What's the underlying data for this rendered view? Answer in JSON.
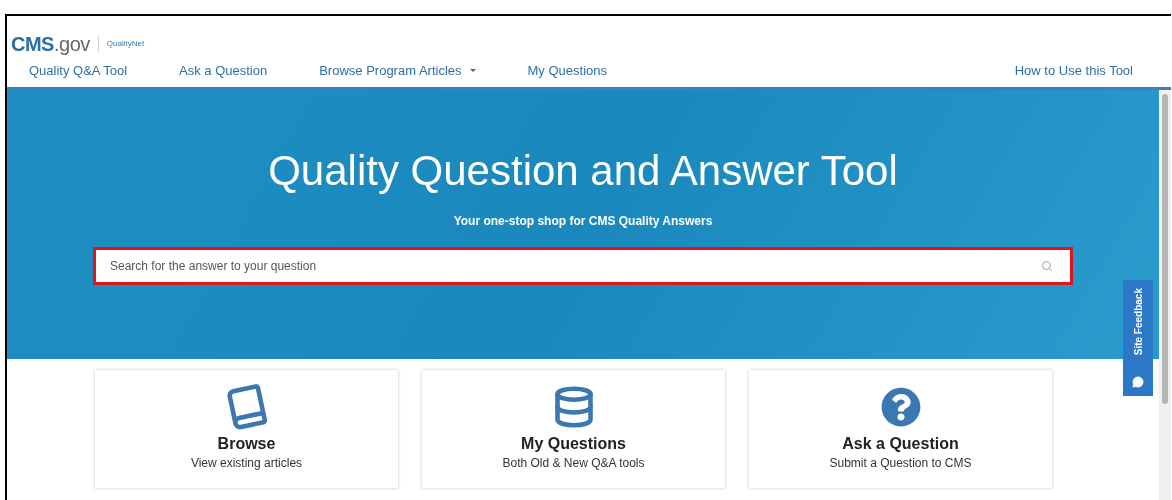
{
  "logo": {
    "brand": "CMS",
    "domain": ".gov",
    "sub": "QualityNet"
  },
  "nav": [
    {
      "label": "Quality Q&A Tool",
      "has_menu": false
    },
    {
      "label": "Ask a Question",
      "has_menu": false
    },
    {
      "label": "Browse Program Articles",
      "has_menu": true
    },
    {
      "label": "My Questions",
      "has_menu": false
    }
  ],
  "nav_right": {
    "label": "How to Use this Tool"
  },
  "hero": {
    "title": "Quality Question and Answer Tool",
    "subtitle": "Your one-stop shop for CMS Quality Answers",
    "search": {
      "placeholder": "Search for the answer to your question"
    }
  },
  "feedback": {
    "label": "Site Feedback"
  },
  "cards": [
    {
      "kind": "book",
      "title": "Browse",
      "subtitle": "View existing articles"
    },
    {
      "kind": "database",
      "title": "My Questions",
      "subtitle": "Both Old & New Q&A tools"
    },
    {
      "kind": "question",
      "title": "Ask a Question",
      "subtitle": "Submit a Question to CMS"
    }
  ]
}
